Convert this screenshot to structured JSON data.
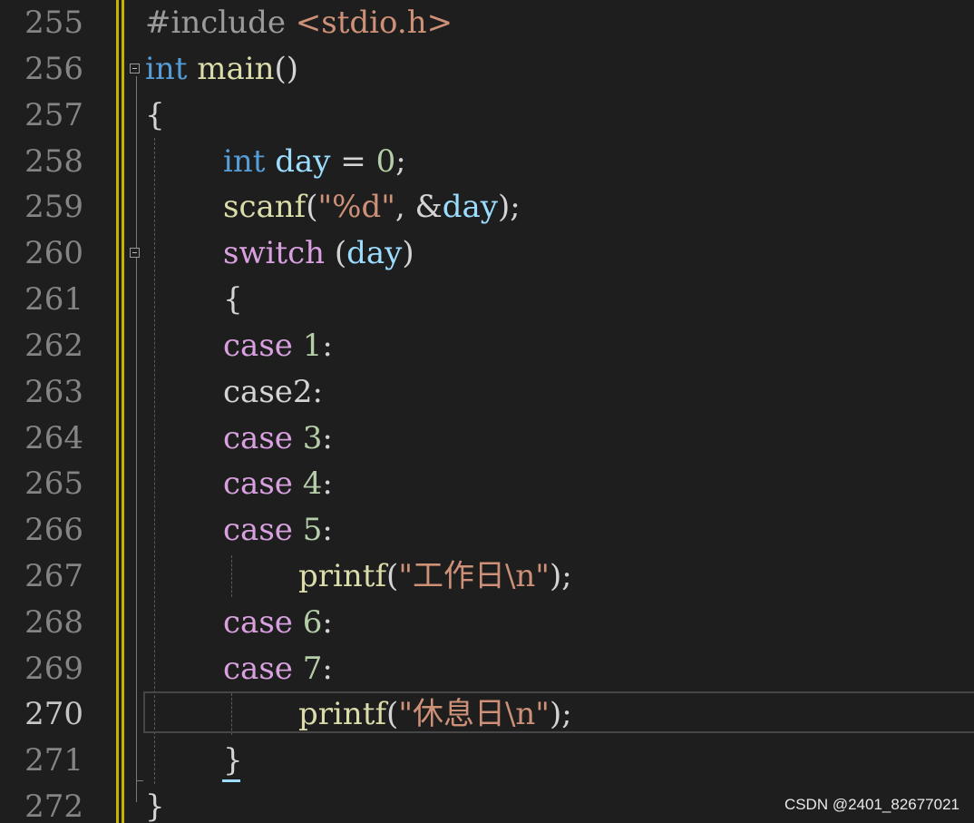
{
  "editor": {
    "line_numbers": [
      "255",
      "256",
      "257",
      "258",
      "259",
      "260",
      "261",
      "262",
      "263",
      "264",
      "265",
      "266",
      "267",
      "268",
      "269",
      "270",
      "271",
      "272"
    ],
    "current_line": "270",
    "lines": {
      "l255": {
        "pre": "#include ",
        "inc": "<stdio.h>"
      },
      "l256": {
        "kw": "int",
        "sp": " ",
        "fn": "main",
        "pn": "()"
      },
      "l257": {
        "pn": "{"
      },
      "l258": {
        "kw": "int",
        "sp": " ",
        "var": "day",
        "op": " = ",
        "num": "0",
        "end": ";"
      },
      "l259": {
        "fn": "scanf",
        "open": "(",
        "str": "\"%d\"",
        "mid": ", &",
        "var": "day",
        "end": ");"
      },
      "l260": {
        "ctl": "switch",
        "mid": " (",
        "var": "day",
        "end": ")"
      },
      "l261": {
        "pn": "{"
      },
      "l262": {
        "ctl": "case",
        "sp": " ",
        "num": "1",
        "end": ":"
      },
      "l263": {
        "plain": "case2:"
      },
      "l264": {
        "ctl": "case",
        "sp": " ",
        "num": "3",
        "end": ":"
      },
      "l265": {
        "ctl": "case",
        "sp": " ",
        "num": "4",
        "end": ":"
      },
      "l266": {
        "ctl": "case",
        "sp": " ",
        "num": "5",
        "end": ":"
      },
      "l267": {
        "fn": "printf",
        "open": "(",
        "str": "\"工作日\\n\"",
        "end": ");"
      },
      "l268": {
        "ctl": "case",
        "sp": " ",
        "num": "6",
        "end": ":"
      },
      "l269": {
        "ctl": "case",
        "sp": " ",
        "num": "7",
        "end": ":"
      },
      "l270": {
        "fn": "printf",
        "open": "(",
        "str": "\"休息日\\n\"",
        "end": ");"
      },
      "l271": {
        "pn": "}"
      },
      "l272": {
        "pn": "}"
      }
    },
    "fold_icons": [
      "collapse-icon",
      "collapse-icon"
    ]
  },
  "watermark": "CSDN @2401_82677021",
  "colors": {
    "background": "#1e1e1e",
    "keyword": "#569cd6",
    "control_keyword": "#d8a0df",
    "function": "#dcdcaa",
    "variable": "#9cdcfe",
    "number": "#b5cea8",
    "string": "#ce9178",
    "line_number": "#858585",
    "change_bar": "#c8b400"
  }
}
